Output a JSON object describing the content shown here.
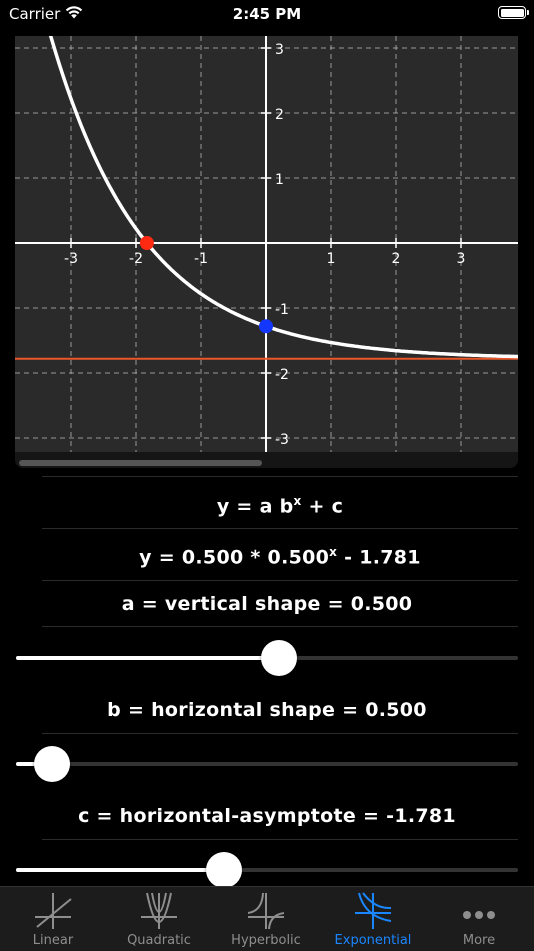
{
  "status": {
    "carrier": "Carrier",
    "time": "2:45 PM"
  },
  "graph": {
    "x_ticks": [
      "-3",
      "-2",
      "-1",
      "1",
      "2",
      "3"
    ],
    "y_ticks": [
      "3",
      "2",
      "1",
      "-1",
      "-2",
      "-3"
    ],
    "curve_color": "#ffffff",
    "asymptote_color": "#e8562a",
    "x_intercept_color": "#ff2a12",
    "y_intercept_color": "#1437ff"
  },
  "formula": {
    "general_base": "y = a b",
    "general_exp": "x",
    "general_tail": " + c",
    "specific_base": "y = 0.500 * 0.500",
    "specific_exp": "x",
    "specific_tail": " - 1.781"
  },
  "params": {
    "a_label": "a = vertical shape = 0.500",
    "a_value": 0.5,
    "b_label": "b = horizontal shape = 0.500",
    "b_value": 0.5,
    "c_label": "c = horizontal-asymptote = -1.781",
    "c_value": -1.781
  },
  "tabs": [
    {
      "label": "Linear",
      "icon": "linear-graph-icon"
    },
    {
      "label": "Quadratic",
      "icon": "quadratic-graph-icon"
    },
    {
      "label": "Hyperbolic",
      "icon": "hyperbolic-graph-icon"
    },
    {
      "label": "Exponential",
      "icon": "exponential-graph-icon",
      "active": true
    },
    {
      "label": "More",
      "icon": "more-dots-icon"
    }
  ],
  "accent_color": "#1a86ff"
}
